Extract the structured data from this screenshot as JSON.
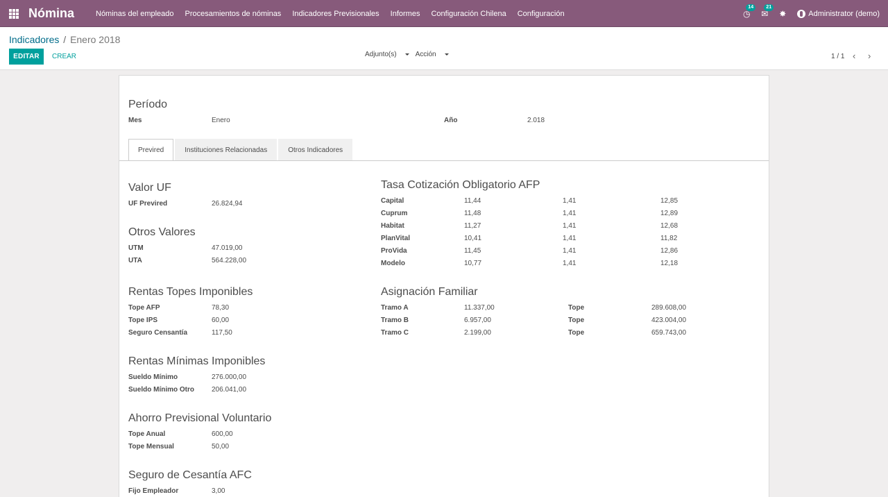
{
  "navbar": {
    "brand": "Nómina",
    "menu": [
      "Nóminas del empleado",
      "Procesamientos de nóminas",
      "Indicadores Previsionales",
      "Informes",
      "Configuración Chilena",
      "Configuración"
    ],
    "activity_badge": "14",
    "messages_badge": "21",
    "user": "Administrator (demo)"
  },
  "breadcrumb": {
    "parent": "Indicadores",
    "separator": "/",
    "current": "Enero 2018"
  },
  "buttons": {
    "edit": "EDITAR",
    "create": "CREAR"
  },
  "dropdowns": {
    "attachments": "Adjunto(s)",
    "action": "Acción"
  },
  "pager": {
    "value": "1 / 1",
    "prev": "‹",
    "next": "›"
  },
  "periodo": {
    "title": "Período",
    "mes_label": "Mes",
    "mes_value": "Enero",
    "anio_label": "Año",
    "anio_value": "2.018"
  },
  "tabs": [
    "Previred",
    "Instituciones Relacionadas",
    "Otros Indicadores"
  ],
  "valor_uf": {
    "title": "Valor UF",
    "rows": [
      {
        "label": "UF Previred",
        "value": "26.824,94"
      }
    ]
  },
  "otros_valores": {
    "title": "Otros Valores",
    "rows": [
      {
        "label": "UTM",
        "value": "47.019,00"
      },
      {
        "label": "UTA",
        "value": "564.228,00"
      }
    ]
  },
  "rentas_topes": {
    "title": "Rentas Topes Imponibles",
    "rows": [
      {
        "label": "Tope AFP",
        "value": "78,30"
      },
      {
        "label": "Tope IPS",
        "value": "60,00"
      },
      {
        "label": "Seguro Censantía",
        "value": "117,50"
      }
    ]
  },
  "rentas_minimas": {
    "title": "Rentas Mínimas Imponibles",
    "rows": [
      {
        "label": "Sueldo Mínimo",
        "value": "276.000,00"
      },
      {
        "label": "Sueldo Mínimo Otro",
        "value": "206.041,00"
      }
    ]
  },
  "ahorro": {
    "title": "Ahorro Previsional Voluntario",
    "rows": [
      {
        "label": "Tope Anual",
        "value": "600,00"
      },
      {
        "label": "Tope Mensual",
        "value": "50,00"
      }
    ]
  },
  "seguro_afc": {
    "title": "Seguro de Cesantía AFC",
    "rows": [
      {
        "label": "Fijo Empleador",
        "value": "3,00"
      }
    ]
  },
  "afp": {
    "title": "Tasa Cotización Obligatorio AFP",
    "rows": [
      {
        "label": "Capital",
        "a": "11,44",
        "b": "1,41",
        "c": "12,85"
      },
      {
        "label": "Cuprum",
        "a": "11,48",
        "b": "1,41",
        "c": "12,89"
      },
      {
        "label": "Habitat",
        "a": "11,27",
        "b": "1,41",
        "c": "12,68"
      },
      {
        "label": "PlanVital",
        "a": "10,41",
        "b": "1,41",
        "c": "11,82"
      },
      {
        "label": "ProVida",
        "a": "11,45",
        "b": "1,41",
        "c": "12,86"
      },
      {
        "label": "Modelo",
        "a": "10,77",
        "b": "1,41",
        "c": "12,18"
      }
    ]
  },
  "asignacion": {
    "title": "Asignación Familiar",
    "rows": [
      {
        "label": "Tramo A",
        "value": "11.337,00",
        "tope_label": "Tope",
        "tope": "289.608,00"
      },
      {
        "label": "Tramo B",
        "value": "6.957,00",
        "tope_label": "Tope",
        "tope": "423.004,00"
      },
      {
        "label": "Tramo C",
        "value": "2.199,00",
        "tope_label": "Tope",
        "tope": "659.743,00"
      }
    ]
  }
}
